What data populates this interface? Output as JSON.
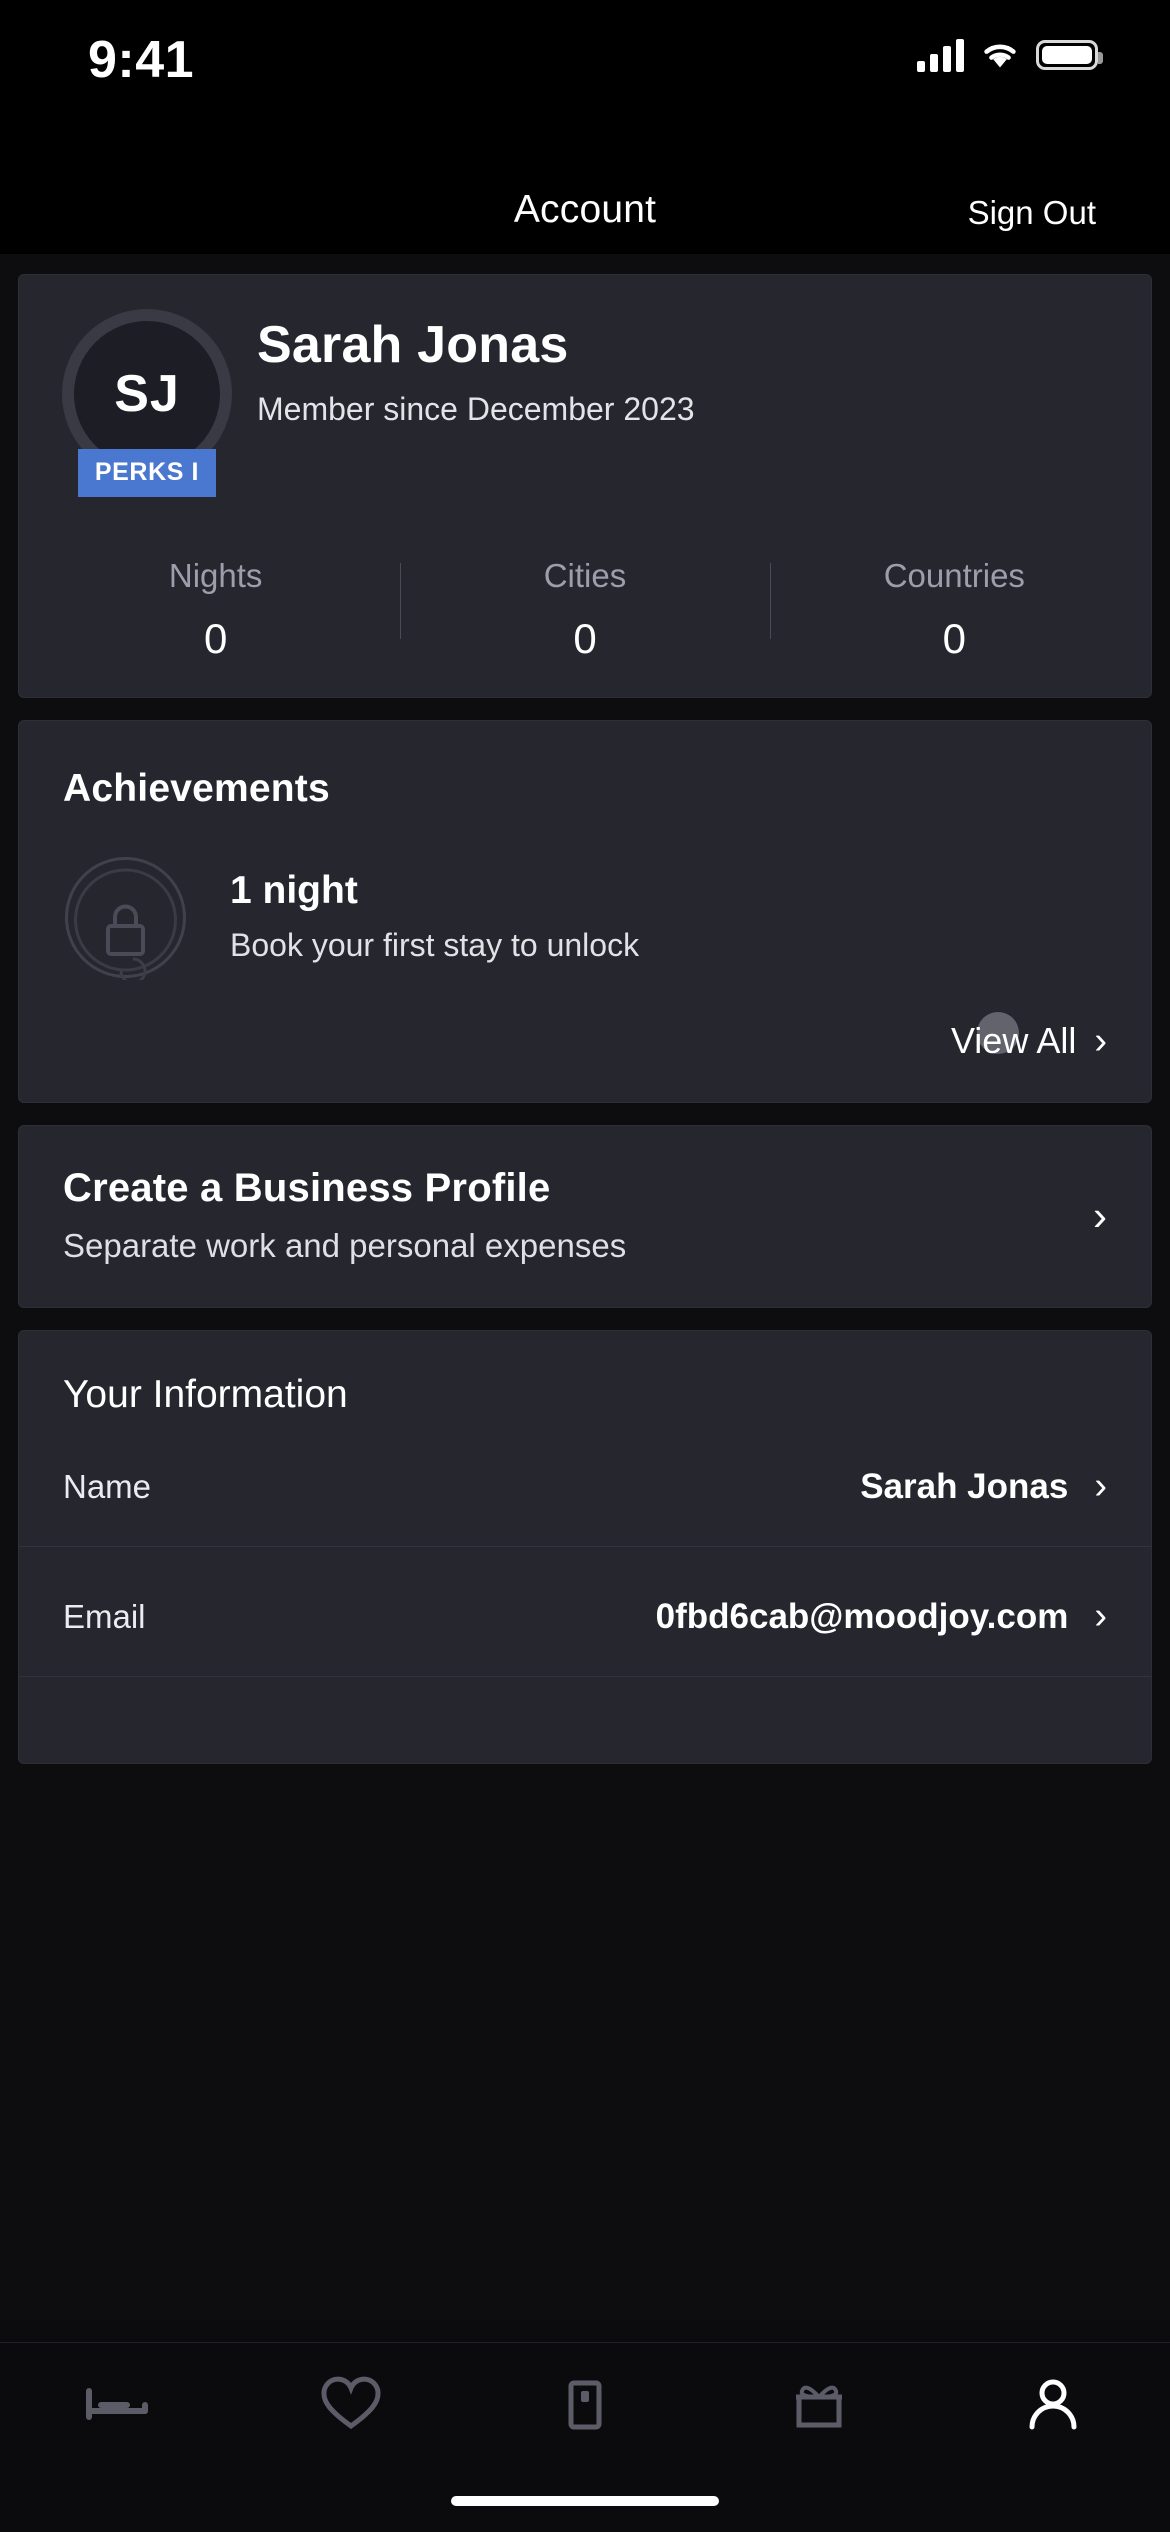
{
  "status_bar": {
    "time": "9:41",
    "cellular_icon": "cellular-signal-icon",
    "wifi_icon": "wifi-icon",
    "battery_icon": "battery-icon"
  },
  "nav": {
    "title": "Account",
    "sign_out_label": "Sign Out"
  },
  "profile": {
    "initials": "SJ",
    "badge": "PERKS I",
    "name": "Sarah Jonas",
    "member_since": "Member since December 2023",
    "badge_color": "#4a78d0",
    "stats": [
      {
        "label": "Nights",
        "value": "0"
      },
      {
        "label": "Cities",
        "value": "0"
      },
      {
        "label": "Countries",
        "value": "0"
      }
    ]
  },
  "achievements": {
    "title": "Achievements",
    "item": {
      "icon": "locked-badge-icon",
      "title": "1 night",
      "subtitle": "Book your first stay to unlock"
    },
    "view_all_label": "View All",
    "chevron": "›"
  },
  "business_profile": {
    "title": "Create a Business Profile",
    "subtitle": "Separate work and personal expenses",
    "chevron": "›"
  },
  "your_information": {
    "title": "Your Information",
    "rows": [
      {
        "label": "Name",
        "value": "Sarah Jonas",
        "chevron": "›"
      },
      {
        "label": "Email",
        "value": "0fbd6cab@moodjoy.com",
        "chevron": "›"
      }
    ]
  },
  "tab_bar": {
    "items": [
      {
        "icon": "stays-bed-icon",
        "active": false
      },
      {
        "icon": "favorites-heart-icon",
        "active": false
      },
      {
        "icon": "trips-door-icon",
        "active": false
      },
      {
        "icon": "rewards-gift-icon",
        "active": false
      },
      {
        "icon": "account-person-icon",
        "active": true
      }
    ],
    "active_color": "#ffffff",
    "inactive_color": "#5c5c68"
  }
}
